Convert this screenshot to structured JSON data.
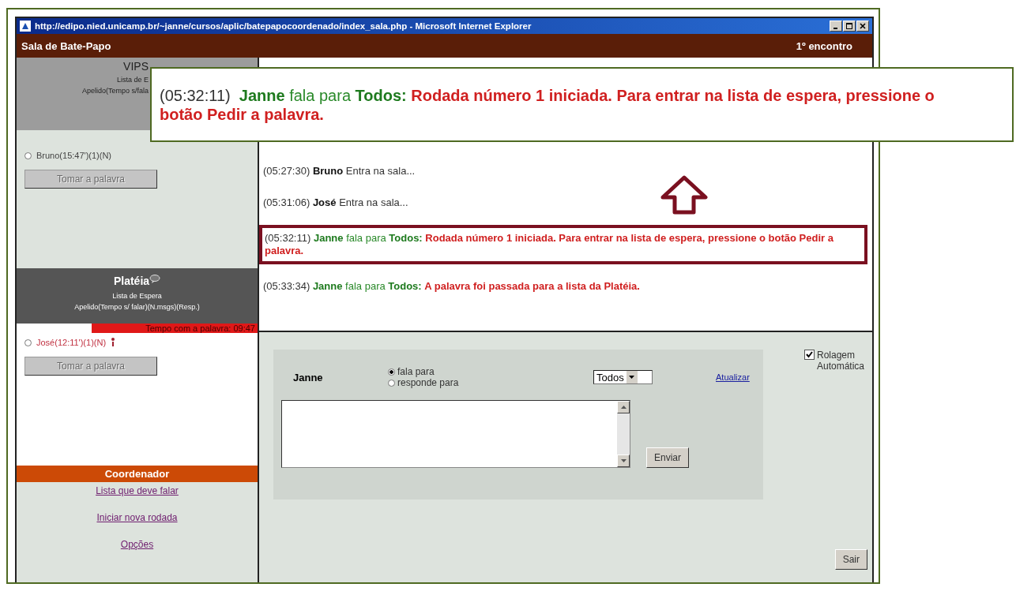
{
  "window": {
    "title": "http://edipo.nied.unicamp.br/~janne/cursos/aplic/batepapocoordenado/index_sala.php - Microsoft Internet Explorer"
  },
  "header": {
    "title": "Sala de Bate-Papo",
    "meeting": "1º encontro"
  },
  "vips": {
    "title": "VIPS",
    "subtitle": "Lista de E",
    "columns": "Apelido(Tempo s/fala",
    "members": [
      {
        "label": "Bruno(15:47')(1)(N)",
        "selected": false
      }
    ],
    "button": {
      "label": "Tomar a palavra",
      "disabled": true
    }
  },
  "plateia": {
    "title": "Platéia",
    "subtitle": "Lista de Espera",
    "columns": "Apelido(Tempo s/ falar)(N.msgs)(Resp.)",
    "timer": "Tempo com a palavra: 09:47",
    "members": [
      {
        "label": "José(12:11')(1)(N)",
        "selected": false
      }
    ],
    "button": {
      "label": "Tomar a palavra",
      "disabled": true
    }
  },
  "coordinator": {
    "title": "Coordenador",
    "links": [
      "Lista que deve falar",
      "Iniciar nova rodada",
      "Opções"
    ]
  },
  "messages": [
    {
      "kind": "system",
      "time": "(05:27:30)",
      "name": "Bruno",
      "text": "Entra na sala...",
      "highlighted": false
    },
    {
      "kind": "system",
      "time": "(05:31:06)",
      "name": "José",
      "text": "Entra na sala...",
      "highlighted": false
    },
    {
      "kind": "speech",
      "time": "(05:32:11)",
      "name": "Janne",
      "verb": "fala para",
      "target": "Todos:",
      "text": "Rodada número 1 iniciada. Para entrar na lista de espera, pressione o botão Pedir a palavra.",
      "highlighted": true
    },
    {
      "kind": "speech",
      "time": "(05:33:34)",
      "name": "Janne",
      "verb": "fala para",
      "target": "Todos:",
      "text": "A palavra foi passada para a lista da Platéia.",
      "highlighted": false
    }
  ],
  "callout": {
    "time": "(05:32:11)",
    "name": "Janne",
    "verb": "fala para",
    "target": "Todos:",
    "text": "Rodada número 1 iniciada. Para entrar na lista de espera, pressione o botão Pedir a palavra."
  },
  "composer": {
    "user": "Janne",
    "modes": [
      {
        "label": "fala para",
        "selected": true
      },
      {
        "label": "responde para",
        "selected": false
      }
    ],
    "recipient": "Todos",
    "refresh": "Atualizar",
    "send": "Enviar",
    "autoscroll": {
      "label": "Rolagem Automática",
      "checked": true
    },
    "exit": "Sair"
  }
}
